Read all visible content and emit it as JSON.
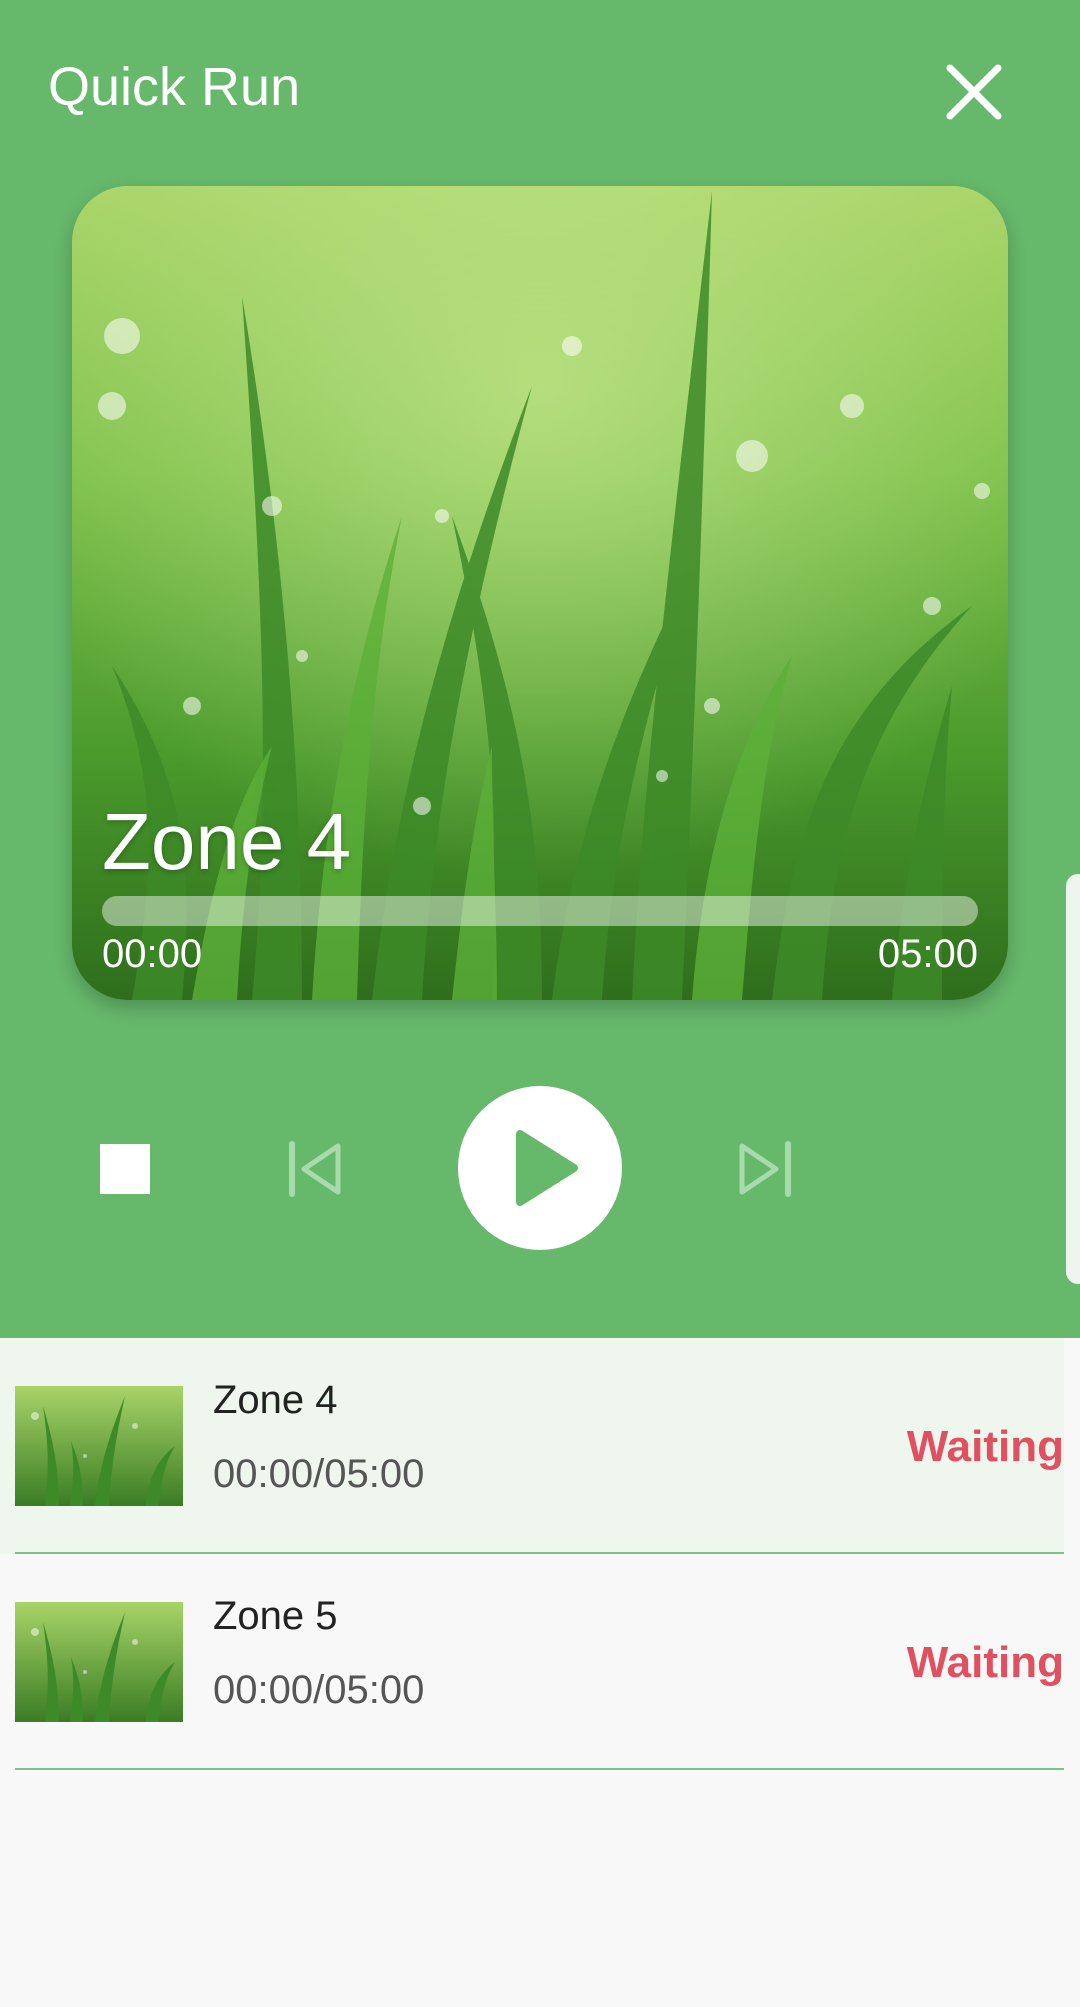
{
  "header": {
    "title": "Quick Run",
    "close_icon": "close-icon"
  },
  "now_playing": {
    "zone_name": "Zone 4",
    "elapsed": "00:00",
    "duration": "05:00",
    "progress": 0.0
  },
  "controls": {
    "stop_icon": "stop-icon",
    "previous_icon": "skip-previous-icon",
    "play_icon": "play-icon",
    "next_icon": "skip-next-icon"
  },
  "zones": [
    {
      "name": "Zone 4",
      "time": "00:00/05:00",
      "status": "Waiting",
      "active": true
    },
    {
      "name": "Zone 5",
      "time": "00:00/05:00",
      "status": "Waiting",
      "active": false
    }
  ],
  "colors": {
    "header_green": "#66b86b",
    "status_red": "#e05060",
    "active_row": "#eef6ee",
    "divider": "#7cc47f"
  }
}
